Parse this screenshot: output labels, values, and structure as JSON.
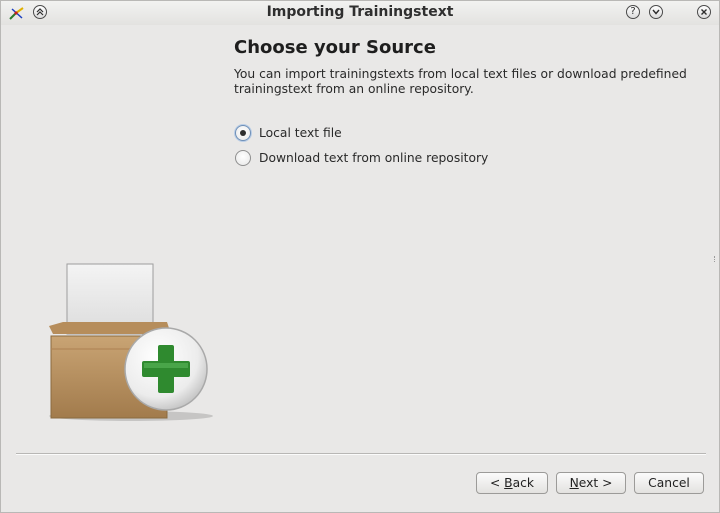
{
  "window": {
    "title": "Importing Trainingstext",
    "title_buttons": [
      "help-icon",
      "minimize-icon",
      "close-icon"
    ],
    "left_buttons": [
      "app-icon",
      "keep-above-icon"
    ]
  },
  "page": {
    "heading": "Choose your Source",
    "description": "You can import trainingstexts from local text files or download predefined trainingstext from an online repository.",
    "options": [
      {
        "label": "Local text file",
        "checked": true
      },
      {
        "label": "Download text from online repository",
        "checked": false
      }
    ]
  },
  "illustration": {
    "icon": "box-add-icon"
  },
  "buttons": {
    "back": {
      "prefix": "< ",
      "mnemonic": "B",
      "rest": "ack"
    },
    "next": {
      "mnemonic": "N",
      "rest": "ext >"
    },
    "cancel": "Cancel"
  }
}
